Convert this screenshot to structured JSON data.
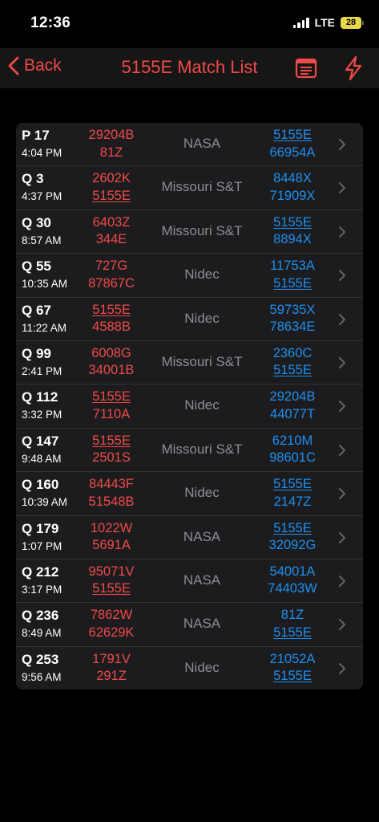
{
  "status": {
    "time": "12:36",
    "network": "LTE",
    "battery": "28"
  },
  "nav": {
    "back_label": "Back",
    "title": "5155E Match List",
    "accent": "#f04a4a",
    "icons": [
      "list-icon",
      "bolt-icon"
    ]
  },
  "colors": {
    "red": "#f04a4a",
    "blue": "#1e8ff0",
    "card": "#1c1c1e"
  },
  "highlight_team": "5155E",
  "matches": [
    {
      "name": "P 17",
      "time": "4:04 PM",
      "red": [
        "29204B",
        "81Z"
      ],
      "venue": "NASA",
      "blue": [
        "5155E",
        "66954A"
      ]
    },
    {
      "name": "Q 3",
      "time": "4:37 PM",
      "red": [
        "2602K",
        "5155E"
      ],
      "venue": "Missouri S&T",
      "blue": [
        "8448X",
        "71909X"
      ]
    },
    {
      "name": "Q 30",
      "time": "8:57 AM",
      "red": [
        "6403Z",
        "344E"
      ],
      "venue": "Missouri S&T",
      "blue": [
        "5155E",
        "8894X"
      ]
    },
    {
      "name": "Q 55",
      "time": "10:35 AM",
      "red": [
        "727G",
        "87867C"
      ],
      "venue": "Nidec",
      "blue": [
        "11753A",
        "5155E"
      ]
    },
    {
      "name": "Q 67",
      "time": "11:22 AM",
      "red": [
        "5155E",
        "4588B"
      ],
      "venue": "Nidec",
      "blue": [
        "59735X",
        "78634E"
      ]
    },
    {
      "name": "Q 99",
      "time": "2:41 PM",
      "red": [
        "6008G",
        "34001B"
      ],
      "venue": "Missouri S&T",
      "blue": [
        "2360C",
        "5155E"
      ]
    },
    {
      "name": "Q 112",
      "time": "3:32 PM",
      "red": [
        "5155E",
        "7110A"
      ],
      "venue": "Nidec",
      "blue": [
        "29204B",
        "44077T"
      ]
    },
    {
      "name": "Q 147",
      "time": "9:48 AM",
      "red": [
        "5155E",
        "2501S"
      ],
      "venue": "Missouri S&T",
      "blue": [
        "6210M",
        "98601C"
      ]
    },
    {
      "name": "Q 160",
      "time": "10:39 AM",
      "red": [
        "84443F",
        "51548B"
      ],
      "venue": "Nidec",
      "blue": [
        "5155E",
        "2147Z"
      ]
    },
    {
      "name": "Q 179",
      "time": "1:07 PM",
      "red": [
        "1022W",
        "5691A"
      ],
      "venue": "NASA",
      "blue": [
        "5155E",
        "32092G"
      ]
    },
    {
      "name": "Q 212",
      "time": "3:17 PM",
      "red": [
        "95071V",
        "5155E"
      ],
      "venue": "NASA",
      "blue": [
        "54001A",
        "74403W"
      ]
    },
    {
      "name": "Q 236",
      "time": "8:49 AM",
      "red": [
        "7862W",
        "62629K"
      ],
      "venue": "NASA",
      "blue": [
        "81Z",
        "5155E"
      ]
    },
    {
      "name": "Q 253",
      "time": "9:56 AM",
      "red": [
        "1791V",
        "291Z"
      ],
      "venue": "Nidec",
      "blue": [
        "21052A",
        "5155E"
      ]
    }
  ]
}
